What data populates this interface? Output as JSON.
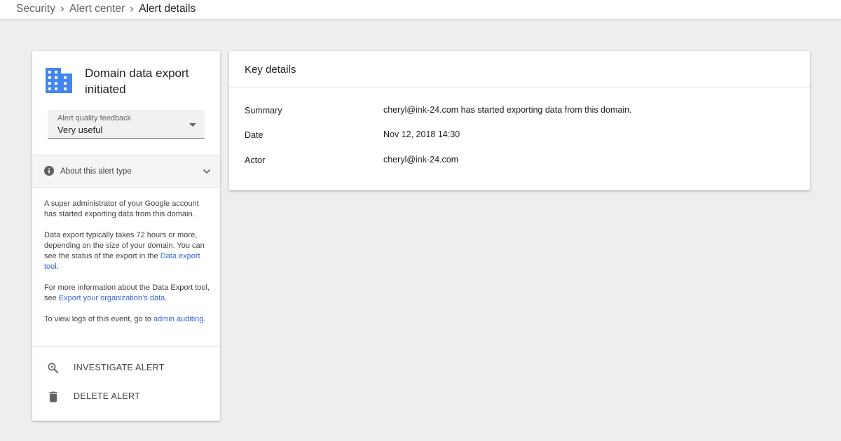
{
  "colors": {
    "background": "#eeeeee",
    "card": "#ffffff",
    "accent_blue": "#4285f4",
    "link_blue": "#3367d6",
    "icon_grey": "#616161"
  },
  "breadcrumb": {
    "items": [
      "Security",
      "Alert center",
      "Alert details"
    ],
    "separator_icon": "chevron-right-icon"
  },
  "alert": {
    "icon": "building-icon",
    "title": "Domain data export initiated",
    "feedback": {
      "label": "Alert quality feedback",
      "value": "Very useful"
    },
    "about": {
      "label": "About this alert type",
      "icon": "info-icon",
      "expand_icon": "chevron-down-icon",
      "p1": "A super administrator of your Google account has started exporting data from this domain.",
      "p2_text": "Data export typically takes 72 hours or more, depending on the size of your domain. You can see the status of the export in the ",
      "p2_link": "Data export tool",
      "p2_end": ".",
      "p3_text": "For more information about the Data Export tool, see ",
      "p3_link": "Export your organization’s data",
      "p3_end": ".",
      "p4_text": "To view logs of this event, go to ",
      "p4_link": "admin auditing",
      "p4_end": "."
    },
    "actions": {
      "investigate": "INVESTIGATE ALERT",
      "delete": "DELETE ALERT"
    }
  },
  "key_details": {
    "title": "Key details",
    "rows": [
      {
        "label": "Summary",
        "value": "cheryl@ink-24.com has started exporting data from this domain."
      },
      {
        "label": "Date",
        "value": "Nov 12, 2018 14:30"
      },
      {
        "label": "Actor",
        "value": "cheryl@ink-24.com"
      }
    ]
  }
}
